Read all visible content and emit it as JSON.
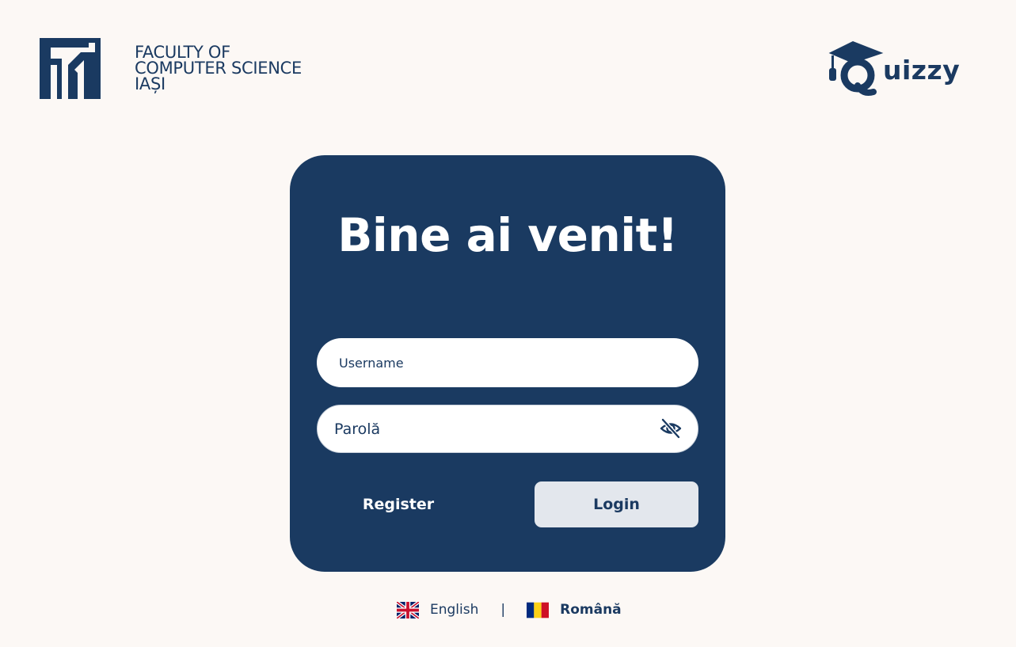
{
  "header": {
    "faculty": {
      "line1": "FACULTY OF",
      "line2": "COMPUTER SCIENCE",
      "line3": "IAȘI"
    },
    "app_name": "uizzy"
  },
  "login_card": {
    "title": "Bine ai venit!",
    "username_placeholder": "Username",
    "password_placeholder": "Parolă",
    "register_label": "Register",
    "login_label": "Login"
  },
  "language_switcher": {
    "english_label": "English",
    "separator": "|",
    "romanian_label": "Română",
    "selected": "Română"
  },
  "icons": {
    "faculty_logo": "fii-logo-icon",
    "app_logo": "graduation-cap-q-icon",
    "password_visibility": "eye-off-icon",
    "english_flag": "uk-flag-icon",
    "romanian_flag": "romania-flag-icon"
  },
  "colors": {
    "background": "#fcf8f5",
    "brand_navy": "#1a3a61",
    "login_button_bg": "#e3e7ed",
    "white": "#ffffff"
  }
}
